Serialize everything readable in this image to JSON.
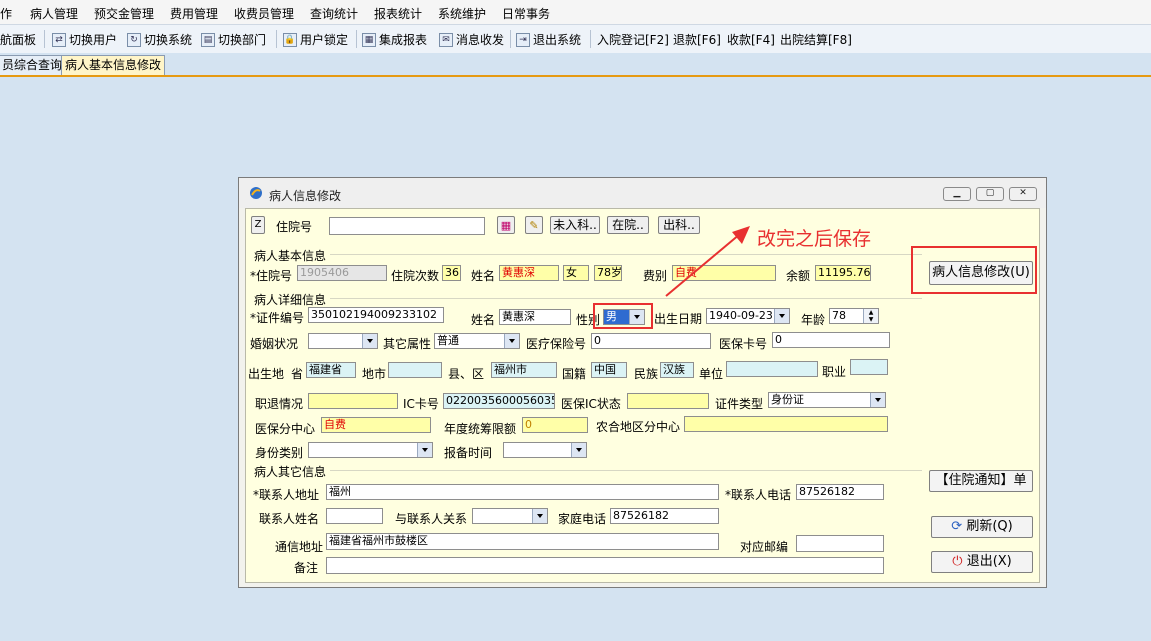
{
  "menu": [
    "作",
    "病人管理",
    "预交金管理",
    "费用管理",
    "收费员管理",
    "查询统计",
    "报表统计",
    "系统维护",
    "日常事务"
  ],
  "toolbar": {
    "nav_panel": "航面板",
    "switch_user": "切换用户",
    "switch_system": "切换系统",
    "switch_dept": "切换部门",
    "user_lock": "用户锁定",
    "integrated_report": "集成报表",
    "messages": "消息收发",
    "exit_system": "退出系统",
    "admission": "入院登记[F2]",
    "refund": "退款[F6]",
    "collect": "收款[F4]",
    "discharge": "出院结算[F8]"
  },
  "tabs": [
    "员综合查询",
    "病人基本信息修改"
  ],
  "dialog": {
    "title": "病人信息修改",
    "search": {
      "z_label": "Z",
      "inpatient_no_label": "住院号",
      "inpatient_no_value": "",
      "btn_not_admitted": "未入科..",
      "btn_in_hospital": "在院..",
      "btn_discharged": "出科.."
    },
    "annotation": "改完之后保存",
    "basic": {
      "section": "病人基本信息",
      "inpatient_no_label": "*住院号",
      "inpatient_no": "1905406",
      "visits_label": "住院次数",
      "visits": "36",
      "name_label": "姓名",
      "name": "黄惠深",
      "gender": "女",
      "age": "78岁",
      "fee_type_label": "费别",
      "fee_type": "自费",
      "balance_label": "余额",
      "balance": "11195.76"
    },
    "detail": {
      "section": "病人详细信息",
      "id_no_label": "*证件编号",
      "id_no": "350102194009233102",
      "name_label": "姓名",
      "name": "黄惠深",
      "gender_label": "性别",
      "gender": "男",
      "birth_label": "出生日期",
      "birth": "1940-09-23",
      "age_label": "年龄",
      "age": "78",
      "marital_label": "婚姻状况",
      "marital": "",
      "other_attr_label": "其它属性",
      "other_attr": "普通",
      "insurance_no_label": "医疗保险号",
      "insurance_no": "0",
      "card_no_label": "医保卡号",
      "card_no": "0",
      "birthplace_label": "出生地",
      "province_label": "省",
      "province": "福建省",
      "city_label": "地市",
      "city": "",
      "county_label": "县、区",
      "county": "福州市",
      "nationality_label": "国籍",
      "nationality": "中国",
      "ethnicity_label": "民族",
      "ethnicity": "汉族",
      "employer_label": "单位",
      "employer": "",
      "occupation_label": "职业",
      "occupation": "",
      "retire_label": "职退情况",
      "retire": "",
      "ic_label": "IC卡号",
      "ic": "0220035600056035",
      "ic_status_label": "医保IC状态",
      "ic_status": "",
      "id_type_label": "证件类型",
      "id_type": "身份证",
      "ins_center_label": "医保分中心",
      "ins_center": "自费",
      "annual_limit_label": "年度统筹限额",
      "annual_limit": "0",
      "rural_center_label": "农合地区分中心",
      "rural_center": "",
      "identity_label": "身份类别",
      "identity": "",
      "report_time_label": "报备时间",
      "report_time": ""
    },
    "other": {
      "section": "病人其它信息",
      "contact_addr_label": "*联系人地址",
      "contact_addr": "福州",
      "contact_phone_label": "*联系人电话",
      "contact_phone": "87526182",
      "contact_name_label": "联系人姓名",
      "contact_name": "",
      "relation_label": "与联系人关系",
      "relation": "",
      "home_phone_label": "家庭电话",
      "home_phone": "87526182",
      "mail_addr_label": "通信地址",
      "mail_addr": "福建省福州市鼓楼区",
      "postcode_label": "对应邮编",
      "postcode": "",
      "remark_label": "备注",
      "remark": ""
    },
    "side": {
      "modify": "病人信息修改(U)",
      "notice": "【住院通知】单",
      "refresh": "刷新(Q)",
      "exit": "退出(X)"
    }
  }
}
